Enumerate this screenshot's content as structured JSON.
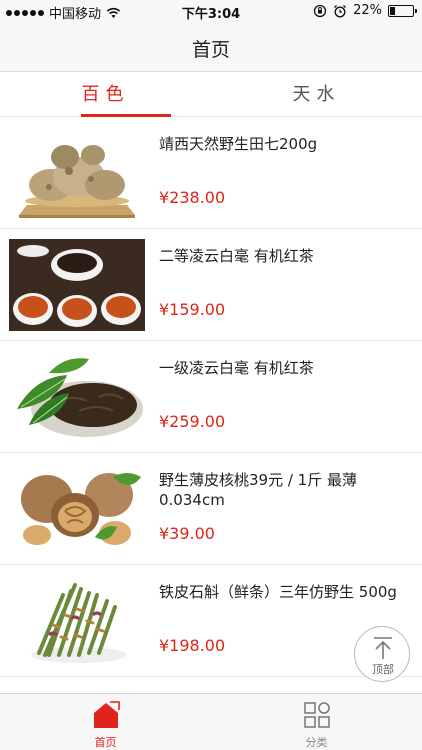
{
  "status_bar": {
    "carrier": "中国移动",
    "time": "下午3:04",
    "battery": "22%",
    "battery_level": 0.22
  },
  "nav": {
    "title": "首页"
  },
  "tabs": [
    {
      "label": "百色",
      "selected": true
    },
    {
      "label": "天水",
      "selected": false
    }
  ],
  "products": [
    {
      "name": "靖西天然野生田七200g",
      "price": "¥238.00",
      "image": "tianqi-root-image"
    },
    {
      "name": "二等凌云白毫 有机红茶",
      "price": "¥159.00",
      "image": "black-tea-cups-image"
    },
    {
      "name": "一级凌云白毫  有机红茶",
      "price": "¥259.00",
      "image": "tea-leaves-image"
    },
    {
      "name": "野生薄皮核桃39元 / 1斤  最薄0.034cm",
      "price": "¥39.00",
      "image": "walnuts-image"
    },
    {
      "name": "铁皮石斛（鲜条）三年仿野生 500g",
      "price": "¥198.00",
      "image": "dendrobium-image"
    }
  ],
  "back_to_top": {
    "label": "顶部",
    "icon": "arrow-up-icon"
  },
  "tabbar": [
    {
      "label": "首页",
      "icon": "home-icon",
      "active": true
    },
    {
      "label": "分类",
      "icon": "category-grid-icon",
      "active": false
    }
  ],
  "colors": {
    "accent": "#e0241a",
    "background": "#f7f7f7"
  }
}
